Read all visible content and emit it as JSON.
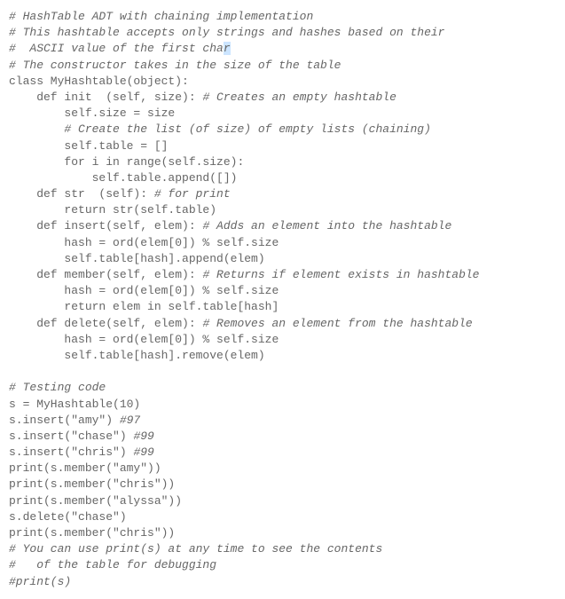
{
  "lines": [
    {
      "text": "# HashTable ADT with chaining implementation",
      "comment": true
    },
    {
      "text": "# This hashtable accepts only strings and hashes based on their",
      "comment": true
    },
    {
      "text": "#  ASCII value of the first char",
      "comment": true,
      "highlight_last": true
    },
    {
      "text": "# The constructor takes in the size of the table",
      "comment": true
    },
    {
      "text": "class MyHashtable(object):",
      "comment": false
    },
    {
      "text": "    def init  (self, size): # Creates an empty hashtable",
      "comment": false,
      "partial_comment": "# Creates an empty hashtable"
    },
    {
      "text": "        self.size = size",
      "comment": false
    },
    {
      "text": "        # Create the list (of size) of empty lists (chaining)",
      "comment": true,
      "indent": 8
    },
    {
      "text": "        self.table = []",
      "comment": false
    },
    {
      "text": "        for i in range(self.size):",
      "comment": false
    },
    {
      "text": "            self.table.append([])",
      "comment": false
    },
    {
      "text": "    def str  (self): # for print",
      "comment": false,
      "partial_comment": "# for print"
    },
    {
      "text": "        return str(self.table)",
      "comment": false
    },
    {
      "text": "    def insert(self, elem): # Adds an element into the hashtable",
      "comment": false,
      "partial_comment": "# Adds an element into the hashtable"
    },
    {
      "text": "        hash = ord(elem[0]) % self.size",
      "comment": false
    },
    {
      "text": "        self.table[hash].append(elem)",
      "comment": false
    },
    {
      "text": "    def member(self, elem): # Returns if element exists in hashtable",
      "comment": false,
      "partial_comment": "# Returns if element exists in hashtable"
    },
    {
      "text": "        hash = ord(elem[0]) % self.size",
      "comment": false
    },
    {
      "text": "        return elem in self.table[hash]",
      "comment": false
    },
    {
      "text": "    def delete(self, elem): # Removes an element from the hashtable",
      "comment": false,
      "partial_comment": "# Removes an element from the hashtable"
    },
    {
      "text": "        hash = ord(elem[0]) % self.size",
      "comment": false
    },
    {
      "text": "        self.table[hash].remove(elem)",
      "comment": false
    },
    {
      "text": "",
      "comment": false
    },
    {
      "text": "# Testing code",
      "comment": true
    },
    {
      "text": "s = MyHashtable(10)",
      "comment": false
    },
    {
      "text": "s.insert(\"amy\") #97",
      "comment": false,
      "partial_comment": "#97"
    },
    {
      "text": "s.insert(\"chase\") #99",
      "comment": false,
      "partial_comment": "#99"
    },
    {
      "text": "s.insert(\"chris\") #99",
      "comment": false,
      "partial_comment": "#99"
    },
    {
      "text": "print(s.member(\"amy\"))",
      "comment": false
    },
    {
      "text": "print(s.member(\"chris\"))",
      "comment": false
    },
    {
      "text": "print(s.member(\"alyssa\"))",
      "comment": false
    },
    {
      "text": "s.delete(\"chase\")",
      "comment": false
    },
    {
      "text": "print(s.member(\"chris\"))",
      "comment": false
    },
    {
      "text": "# You can use print(s) at any time to see the contents",
      "comment": true
    },
    {
      "text": "#   of the table for debugging",
      "comment": true
    },
    {
      "text": "#print(s)",
      "comment": true
    }
  ]
}
